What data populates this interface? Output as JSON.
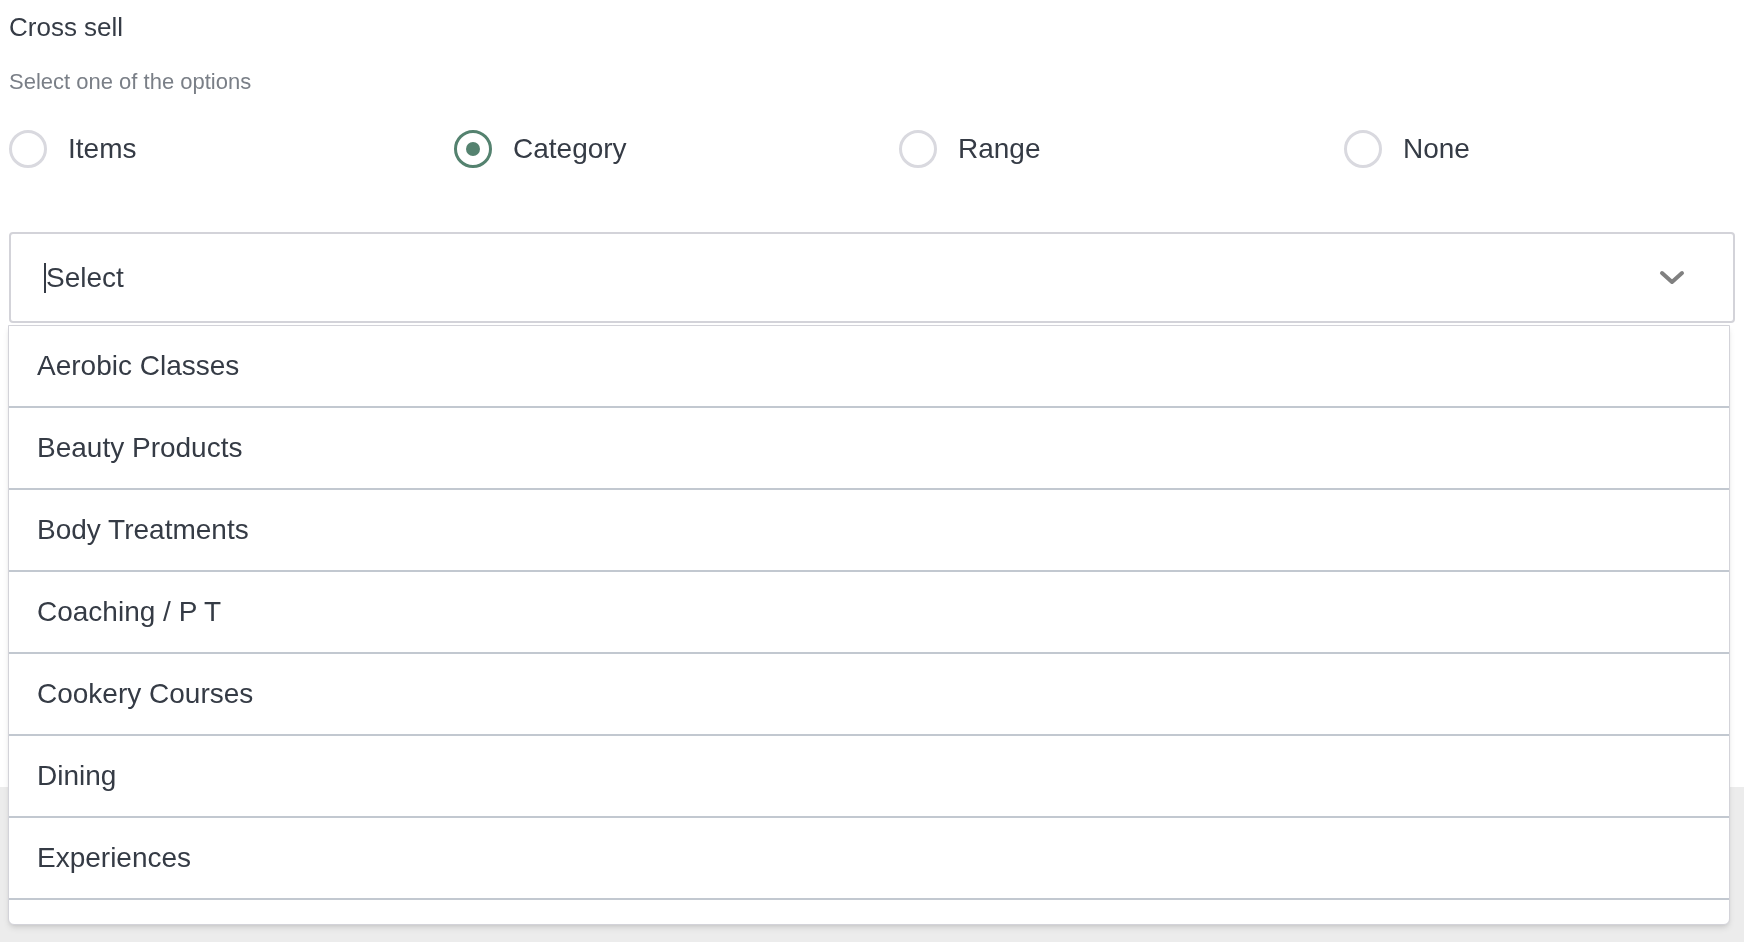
{
  "section": {
    "title": "Cross sell",
    "hint": "Select one of the options"
  },
  "options": [
    {
      "label": "Items",
      "selected": false
    },
    {
      "label": "Category",
      "selected": true
    },
    {
      "label": "Range",
      "selected": false
    },
    {
      "label": "None",
      "selected": false
    }
  ],
  "select": {
    "placeholder": "Select",
    "expanded": true
  },
  "menu_items": [
    {
      "label": "Aerobic Classes"
    },
    {
      "label": "Beauty Products"
    },
    {
      "label": "Body Treatments"
    },
    {
      "label": "Coaching / P T"
    },
    {
      "label": "Cookery Courses"
    },
    {
      "label": "Dining"
    },
    {
      "label": "Experiences"
    }
  ]
}
